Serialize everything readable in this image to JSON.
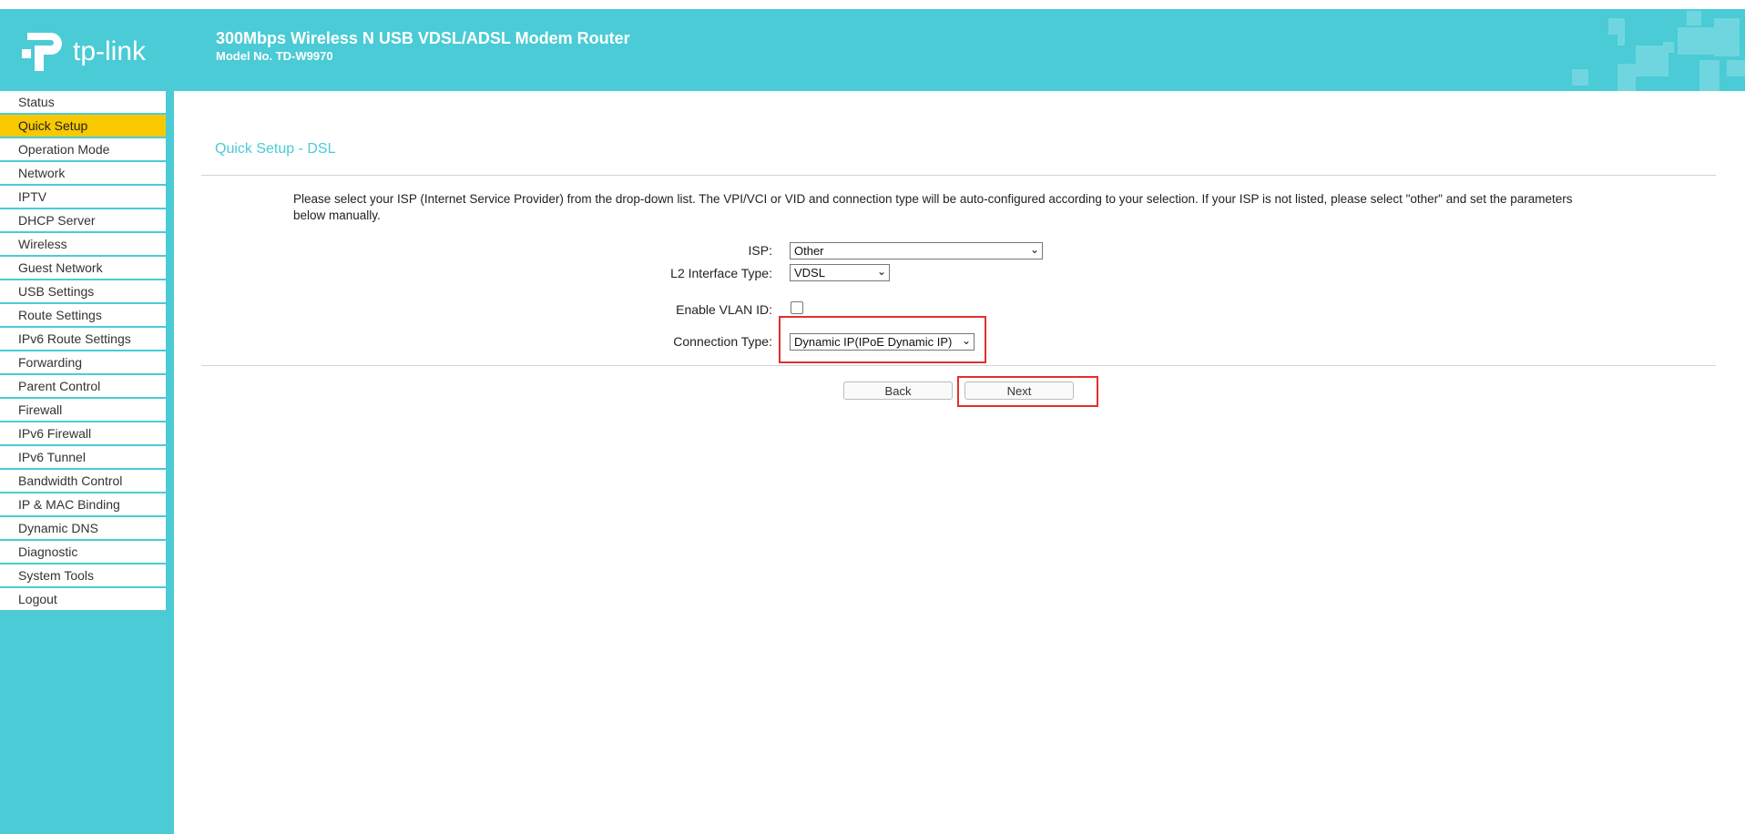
{
  "header": {
    "logo_text": "tp-link",
    "title": "300Mbps Wireless N USB VDSL/ADSL Modem Router",
    "model": "Model No. TD-W9970"
  },
  "sidebar": {
    "items": [
      {
        "label": "Status"
      },
      {
        "label": "Quick Setup",
        "active": true
      },
      {
        "label": "Operation Mode"
      },
      {
        "label": "Network"
      },
      {
        "label": "IPTV"
      },
      {
        "label": "DHCP Server"
      },
      {
        "label": "Wireless"
      },
      {
        "label": "Guest Network"
      },
      {
        "label": "USB Settings"
      },
      {
        "label": "Route Settings"
      },
      {
        "label": "IPv6 Route Settings"
      },
      {
        "label": "Forwarding"
      },
      {
        "label": "Parent Control"
      },
      {
        "label": "Firewall"
      },
      {
        "label": "IPv6 Firewall"
      },
      {
        "label": "IPv6 Tunnel"
      },
      {
        "label": "Bandwidth Control"
      },
      {
        "label": "IP & MAC Binding"
      },
      {
        "label": "Dynamic DNS"
      },
      {
        "label": "Diagnostic"
      },
      {
        "label": "System Tools"
      },
      {
        "label": "Logout"
      }
    ]
  },
  "main": {
    "page_title": "Quick Setup - DSL",
    "description": "Please select your ISP (Internet Service Provider) from the drop-down list. The VPI/VCI or VID and connection type will be auto-configured according to your selection. If your ISP is not listed, please select \"other\" and set the parameters below manually.",
    "isp_label": "ISP:",
    "isp_value": "Other",
    "l2_label": "L2 Interface Type:",
    "l2_value": "VDSL",
    "vlan_label": "Enable VLAN ID:",
    "vlan_checked": false,
    "conn_label": "Connection Type:",
    "conn_value": "Dynamic IP(IPoE Dynamic IP)",
    "back_label": "Back",
    "next_label": "Next"
  },
  "colors": {
    "accent": "#4acbd6",
    "active_menu": "#f8c800",
    "highlight": "#e03030"
  }
}
